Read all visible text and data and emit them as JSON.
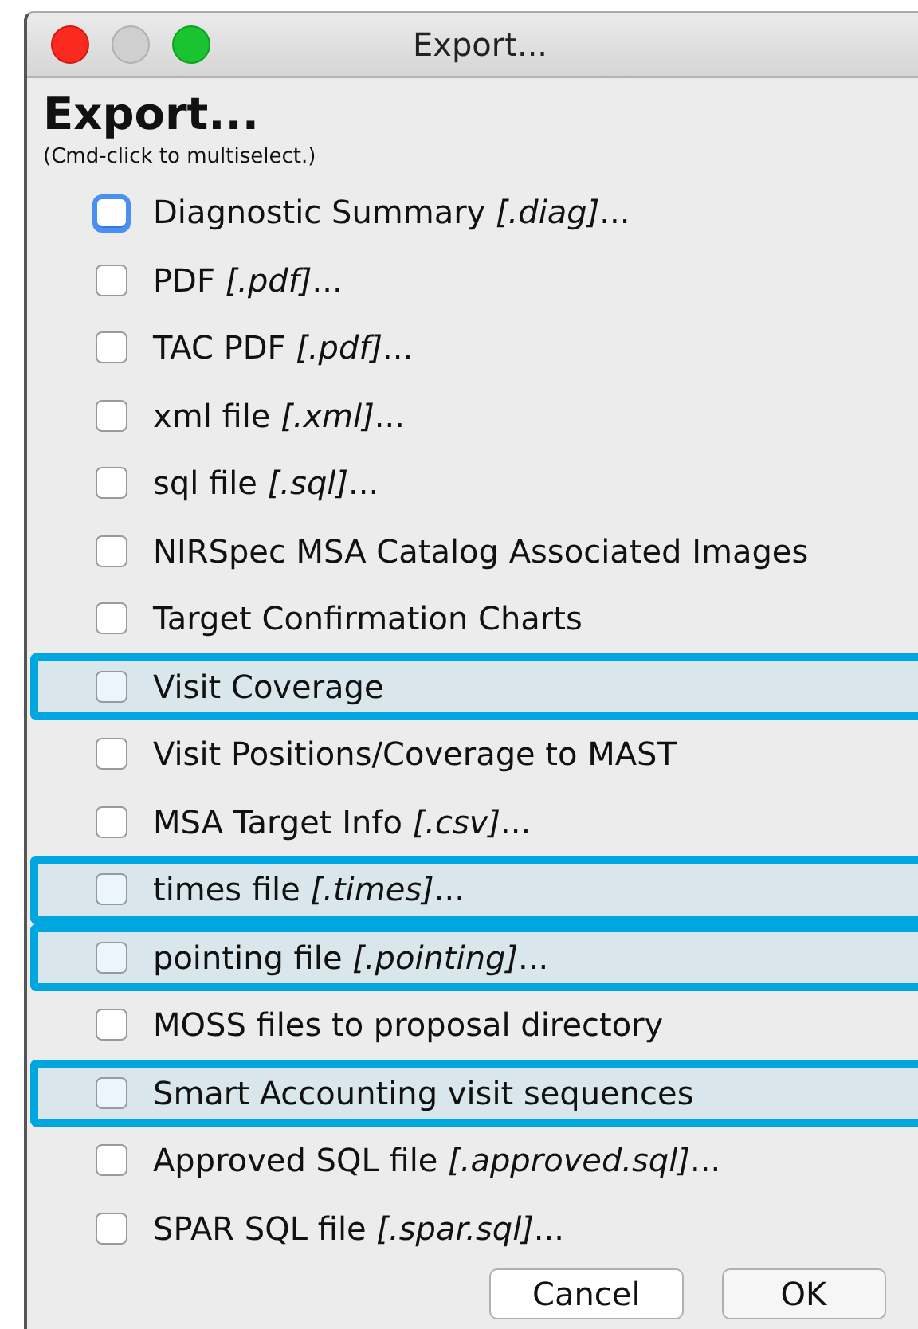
{
  "window": {
    "title": "Export..."
  },
  "heading": "Export...",
  "hint": "(Cmd-click to multiselect.)",
  "options": [
    {
      "label": "Diagnostic Summary *[.diag]*...",
      "checked": false,
      "focused": true,
      "highlighted": false
    },
    {
      "label": "PDF *[.pdf]*...",
      "checked": false,
      "focused": false,
      "highlighted": false
    },
    {
      "label": "TAC PDF *[.pdf]*...",
      "checked": false,
      "focused": false,
      "highlighted": false
    },
    {
      "label": "xml file *[.xml]*...",
      "checked": false,
      "focused": false,
      "highlighted": false
    },
    {
      "label": "sql file *[.sql]*...",
      "checked": false,
      "focused": false,
      "highlighted": false
    },
    {
      "label": "NIRSpec MSA Catalog Associated Images",
      "checked": false,
      "focused": false,
      "highlighted": false
    },
    {
      "label": "Target Confirmation Charts",
      "checked": false,
      "focused": false,
      "highlighted": false
    },
    {
      "label": "Visit Coverage",
      "checked": false,
      "focused": false,
      "highlighted": true
    },
    {
      "label": "Visit Positions/Coverage to MAST",
      "checked": false,
      "focused": false,
      "highlighted": false
    },
    {
      "label": "MSA Target Info *[.csv]*...",
      "checked": false,
      "focused": false,
      "highlighted": false
    },
    {
      "label": "times file *[.times]*...",
      "checked": false,
      "focused": false,
      "highlighted": true
    },
    {
      "label": "pointing file *[.pointing]*...",
      "checked": false,
      "focused": false,
      "highlighted": true
    },
    {
      "label": "MOSS files to proposal directory",
      "checked": false,
      "focused": false,
      "highlighted": false
    },
    {
      "label": "Smart Accounting visit sequences",
      "checked": false,
      "focused": false,
      "highlighted": true
    },
    {
      "label": "Approved SQL file *[.approved.sql]*...",
      "checked": false,
      "focused": false,
      "highlighted": false
    },
    {
      "label": "SPAR SQL file *[.spar.sql]*...",
      "checked": false,
      "focused": false,
      "highlighted": false
    }
  ],
  "buttons": [
    "Cancel",
    "OK"
  ]
}
